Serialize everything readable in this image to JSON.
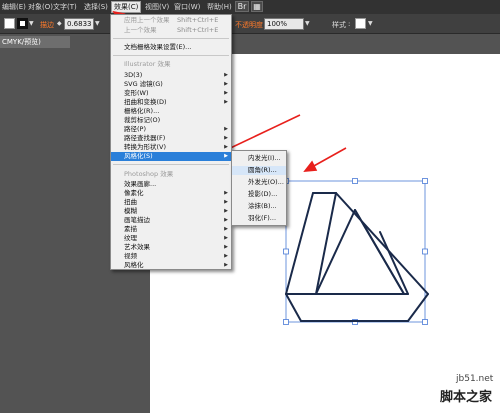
{
  "menubar": {
    "items": [
      "编辑(E)",
      "对象(O)",
      "文字(T)",
      "选择(S)",
      "效果(C)",
      "视图(V)",
      "窗口(W)",
      "帮助(H)"
    ],
    "br_icon": "bridge-icon",
    "layout_icon": "arrange-documents-icon"
  },
  "control": {
    "stroke_label": "描边",
    "stroke_value": "0.6833",
    "opacity_label": "不透明度",
    "opacity_value": "100%",
    "style_label": "样式"
  },
  "doc_tab": "CMYK/预览)",
  "effect_menu": {
    "apply_last": "应用上一个效果",
    "apply_last_shortcut": "Shift+Ctrl+E",
    "last_effect": "上一个效果",
    "last_effect_shortcut": "Shift+Ctrl+E",
    "raster_settings": "文档栅格效果设置(E)...",
    "illustrator_header": "Illustrator 效果",
    "illustrator_items": [
      "3D(3)",
      "SVG 滤镜(G)",
      "变形(W)",
      "扭曲和变换(D)",
      "栅格化(R)...",
      "裁剪标记(O)",
      "路径(P)",
      "路径查找器(F)",
      "转换为形状(V)",
      "风格化(S)"
    ],
    "photoshop_header": "Photoshop 效果",
    "photoshop_items": [
      "效果画廊...",
      "像素化",
      "扭曲",
      "模糊",
      "画笔描边",
      "素描",
      "纹理",
      "艺术效果",
      "视频",
      "风格化"
    ]
  },
  "stylize_submenu": {
    "items": [
      "内发光(I)...",
      "圆角(R)...",
      "外发光(O)...",
      "投影(D)...",
      "涂抹(B)...",
      "羽化(F)..."
    ]
  },
  "colors": {
    "highlight": "#2a7fd9",
    "arrow": "#e8201c",
    "opacity_label": "#ff7a2a",
    "stroke_swatch": "#ffffff",
    "selection": "#4a7bd6",
    "shape_stroke": "#1a2a4a"
  },
  "watermark": {
    "site": "jb51.net",
    "name": "脚本之家"
  }
}
